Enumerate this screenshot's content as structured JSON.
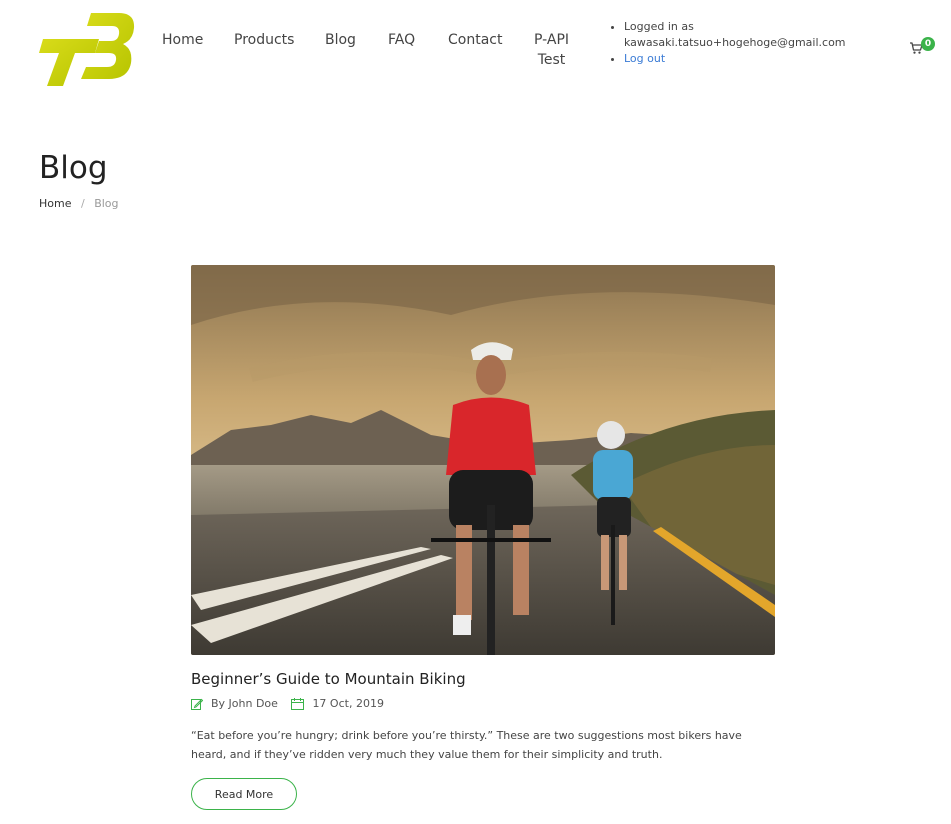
{
  "header": {
    "logo_alt": "TB",
    "nav": [
      {
        "label": "Home"
      },
      {
        "label": "Products"
      },
      {
        "label": "Blog"
      },
      {
        "label": "FAQ"
      },
      {
        "label": "Contact"
      },
      {
        "label_line1": "P-API",
        "label_line2": "Test"
      }
    ],
    "user": {
      "logged_in_label": "Logged in as",
      "email": "kawasaki.tatsuo+hogehoge@gmail.com",
      "logout_label": "Log out"
    },
    "cart": {
      "count": "0",
      "icon": "cart-icon"
    }
  },
  "page": {
    "title": "Blog",
    "breadcrumb": [
      {
        "label": "Home"
      },
      {
        "label": "Blog"
      }
    ]
  },
  "post": {
    "image_alt": "Two cyclists riding on a coastal road at sunset",
    "title": "Beginner’s Guide to Mountain Biking",
    "author": "By John Doe",
    "date": "17 Oct, 2019",
    "excerpt": "“Eat before you’re hungry; drink before you’re thirsty.” These are two suggestions most bikers have heard, and if they’ve ridden very much they value them for their simplicity and truth.",
    "read_more_label": "Read More"
  },
  "colors": {
    "accent_green": "#3bb34a",
    "logo_yellow": "#c8d400",
    "link_blue": "#3a7bd5"
  }
}
